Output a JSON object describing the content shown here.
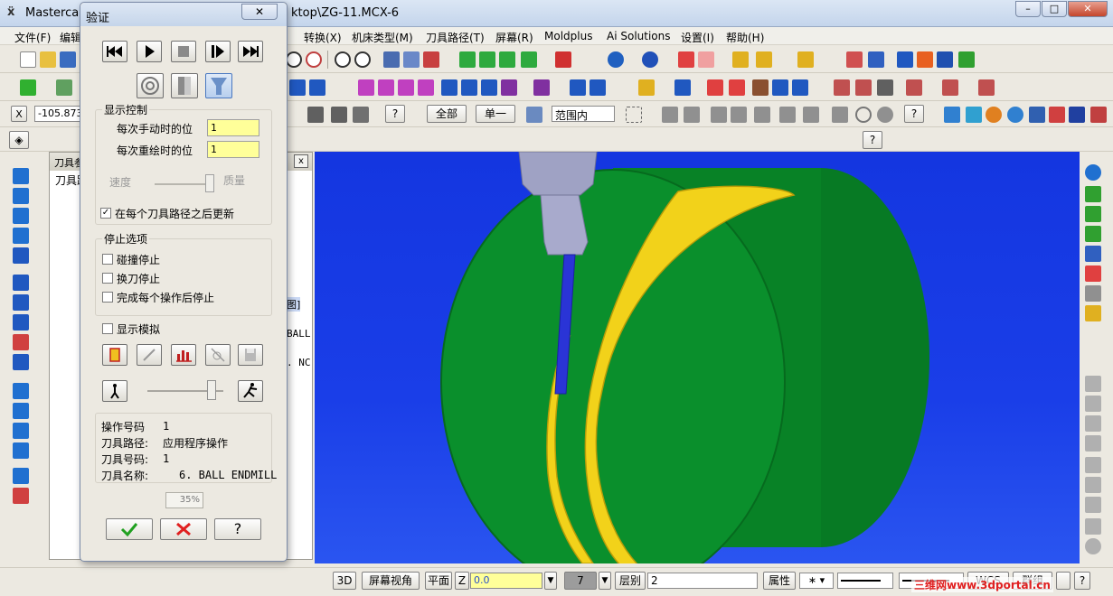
{
  "window": {
    "title_left": "Mastercam",
    "title_right": "ktop\\ZG-11.MCX-6",
    "controls": {
      "minimize": "–",
      "maximize": "□",
      "close": "✕"
    }
  },
  "menu": [
    "文件(F)",
    "编辑",
    "转换(X)",
    "机床类型(M)",
    "刀具路径(T)",
    "屏幕(R)",
    "Moldplus",
    "Ai Solutions",
    "设置(I)",
    "帮助(H)"
  ],
  "toolbar3": {
    "x_label": "X",
    "x_value": "-105.873",
    "all_button": "全部",
    "single_button": "单一",
    "range_select": "范围内"
  },
  "ops_manager": {
    "header": "刀具参",
    "tab": "刀具路",
    "close": "x",
    "fragments": [
      "图]",
      "BALL",
      ". NC"
    ]
  },
  "dialog": {
    "title": "验证",
    "close": "✕",
    "display_group": "显示控制",
    "manual_step_label": "每次手动时的位",
    "manual_step_value": "1",
    "redraw_label": "每次重绘时的位",
    "redraw_value": "1",
    "speed_label": "速度",
    "quality_label": "质量",
    "update_after_each": "在每个刀具路径之后更新",
    "update_checked": true,
    "stop_group": "停止选项",
    "stop_collision": "碰撞停止",
    "stop_tool_change": "换刀停止",
    "stop_each_op": "完成每个操作后停止",
    "show_sim": "显示模拟",
    "info": {
      "op_no_label": "操作号码",
      "op_no_value": "1",
      "toolpath_label": "刀具路径:",
      "toolpath_value": "应用程序操作",
      "tool_no_label": "刀具号码:",
      "tool_no_value": "1",
      "tool_name_label": "刀具名称:",
      "tool_name_value": "6. BALL ENDMILL"
    },
    "progress": "35%",
    "progress_fraction": 0.35
  },
  "statusbar": {
    "btn_3d": "3D",
    "screen_view": "屏幕视角",
    "plane": "平面",
    "z_label": "Z",
    "z_value": "0.0",
    "color_value": "7",
    "level_label": "层别",
    "level_value": "2",
    "attributes": "属性",
    "wcs": "WCS",
    "group": "群组",
    "watermark": "三维网www.3dportal.cn"
  },
  "colors": {
    "viewport_bg": "#1a3ee8",
    "part_green": "#0a8a2a",
    "toolpath_yellow": "#f2d21a",
    "tool_gray": "#a8aab8",
    "input_yellow": "#ffff99"
  }
}
